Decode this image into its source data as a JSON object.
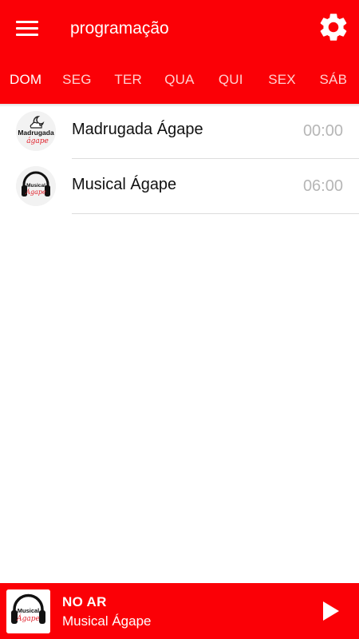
{
  "colors": {
    "primary": "#fb0006",
    "on_primary": "#ffffff",
    "tab_inactive": "#ffd0d0",
    "time_text": "#b6b6b6",
    "divider": "#dddddd"
  },
  "header": {
    "title": "programação",
    "menu_icon": "hamburger-menu-icon",
    "settings_icon": "gear-icon"
  },
  "tabs": [
    {
      "label": "DOM",
      "selected": true
    },
    {
      "label": "SEG",
      "selected": false
    },
    {
      "label": "TER",
      "selected": false
    },
    {
      "label": "QUA",
      "selected": false
    },
    {
      "label": "QUI",
      "selected": false
    },
    {
      "label": "SEX",
      "selected": false
    },
    {
      "label": "SÁB",
      "selected": false
    }
  ],
  "schedule": [
    {
      "name": "Madrugada Ágape",
      "time": "00:00",
      "logo_line1": "Madrugada",
      "logo_line2": "ágape"
    },
    {
      "name": "Musical Ágape",
      "time": "06:00",
      "logo_line1": "Musical",
      "logo_line2": "Ágape"
    }
  ],
  "player": {
    "status": "NO AR",
    "program": "Musical Ágape",
    "art_line1": "Musical",
    "art_line2": "Ágape",
    "play_icon": "play-icon"
  }
}
